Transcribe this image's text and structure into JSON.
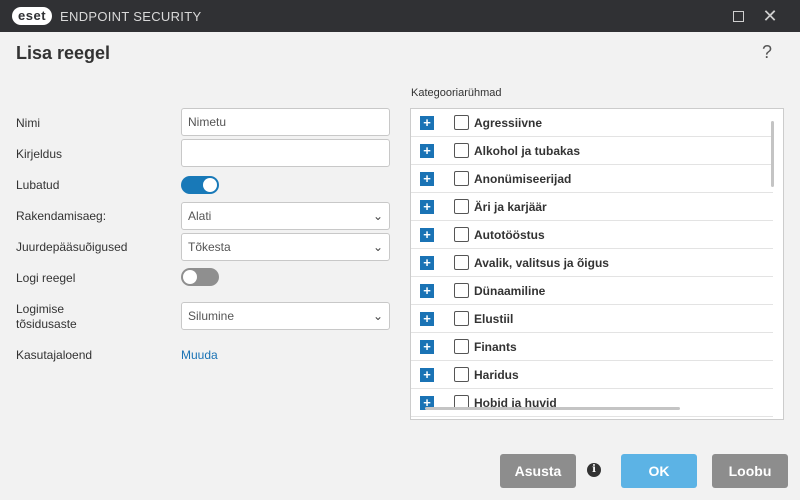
{
  "window": {
    "brand": "eset",
    "title": "ENDPOINT SECURITY",
    "minimize_icon": "square-icon",
    "close_icon": "close-icon"
  },
  "dialog": {
    "title": "Lisa reegel",
    "help": "?"
  },
  "form": {
    "name_label": "Nimi",
    "name_value": "Nimetu",
    "description_label": "Kirjeldus",
    "description_value": "",
    "enabled_label": "Lubatud",
    "enabled": true,
    "apply_time_label": "Rakendamisaeg:",
    "apply_time_value": "Alati",
    "access_label": "Juurdepääsuõigused",
    "access_value": "Tõkesta",
    "log_label": "Logi reegel",
    "log_enabled": false,
    "severity_label_line1": "Logimise",
    "severity_label_line2": "tõsidusaste",
    "severity_value": "Silumine",
    "user_list_label": "Kasutajaloend",
    "user_list_link": "Muuda"
  },
  "categories": {
    "label": "Kategooriarühmad",
    "items": [
      "Agressiivne",
      "Alkohol ja tubakas",
      "Anonümiseerijad",
      "Äri ja karjäär",
      "Autotööstus",
      "Avalik, valitsus ja õigus",
      "Dünaamiline",
      "Elustiil",
      "Finants",
      "Haridus",
      "Hobid ja huvid"
    ]
  },
  "buttons": {
    "setup": "Asusta",
    "info": "i",
    "ok": "OK",
    "cancel": "Loobu"
  },
  "colors": {
    "titlebar": "#303134",
    "accent": "#1a73b5",
    "ok_button": "#5cb3e5",
    "grey_button": "#8d8d8d"
  }
}
